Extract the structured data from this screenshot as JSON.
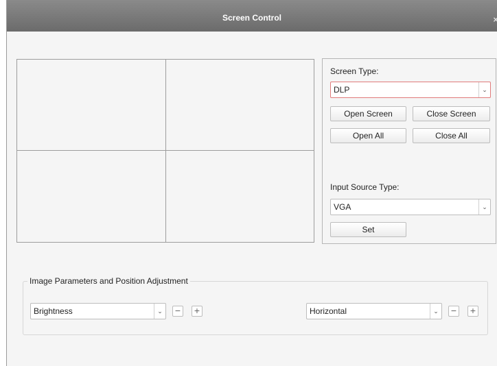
{
  "window": {
    "title": "Screen Control",
    "close_glyph": "×"
  },
  "screen_type": {
    "label": "Screen Type:",
    "selected": "DLP",
    "buttons": {
      "open_screen": "Open Screen",
      "close_screen": "Close Screen",
      "open_all": "Open All",
      "close_all": "Close All"
    }
  },
  "input_source": {
    "label": "Input Source Type:",
    "selected": "VGA",
    "set_label": "Set"
  },
  "image_params": {
    "legend": "Image Parameters and Position Adjustment",
    "param_selected": "Brightness",
    "position_selected": "Horizontal",
    "minus_glyph": "−",
    "plus_glyph": "+"
  },
  "icons": {
    "dropdown": "chevron-down-icon",
    "close": "close-icon",
    "minus": "minus-icon",
    "plus": "plus-icon"
  },
  "colors": {
    "titlebar": "#7a7a7a",
    "active_border": "#e07a7a",
    "panel_bg": "#f5f5f5"
  }
}
